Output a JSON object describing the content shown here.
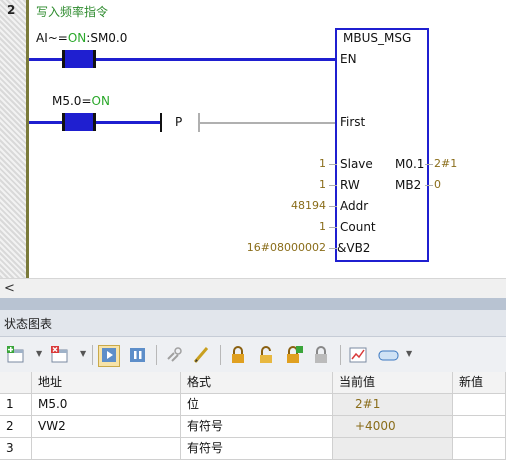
{
  "network": {
    "number": "2",
    "comment": "写入频率指令"
  },
  "rung": {
    "contact1": {
      "label_left": "AI~=",
      "label_state": "ON",
      "label_right": ":SM0.0"
    },
    "contact2": {
      "label_left": "M5.0=",
      "label_state": "ON"
    },
    "p_contact": "P"
  },
  "block": {
    "title": "MBUS_MSG",
    "pins_left": [
      "EN",
      "First",
      "Slave",
      "RW",
      "Addr",
      "Count",
      "&VB2"
    ],
    "pins_right": [
      "M0.1",
      "MB2"
    ],
    "input_values": {
      "slave": "1",
      "rw": "1",
      "addr": "48194",
      "count": "1",
      "data_ptr": "16#08000002"
    },
    "output_values": {
      "done": "2#1",
      "error": "0"
    }
  },
  "scrollbar": {
    "left_arrow": "<"
  },
  "status_chart": {
    "title": "状态图表",
    "columns": [
      "",
      "地址",
      "格式",
      "当前值",
      "新值"
    ],
    "rows": [
      {
        "index": "1",
        "address": "M5.0",
        "format": "位",
        "current": "2#1",
        "new": ""
      },
      {
        "index": "2",
        "address": "VW2",
        "format": "有符号",
        "current": "+4000",
        "new": ""
      },
      {
        "index": "3",
        "address": "",
        "format": "有符号",
        "current": "",
        "new": ""
      }
    ]
  },
  "toolbar": {
    "icons": [
      "add-icon",
      "delete-icon",
      "run-icon",
      "pause-icon",
      "link-icon",
      "pencil-icon",
      "lock-icon",
      "unlock-icon",
      "force-icon",
      "unforce-icon",
      "trend-icon",
      "chart-options-icon"
    ]
  }
}
